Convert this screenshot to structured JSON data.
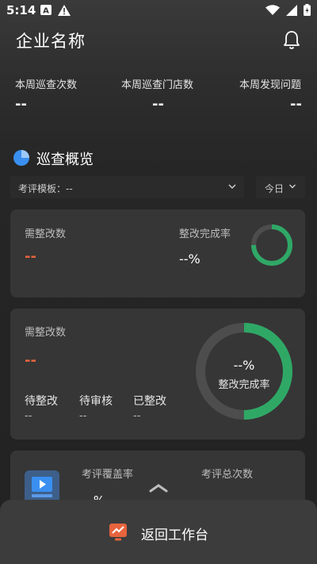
{
  "status_bar": {
    "time": "5:14",
    "badge_label": "A",
    "battery_glyph": "⚡"
  },
  "header": {
    "title": "企业名称",
    "bell_icon": "bell-icon"
  },
  "stats": [
    {
      "label": "本周巡查次数",
      "value": "--"
    },
    {
      "label": "本周巡查门店数",
      "value": "--"
    },
    {
      "label": "本周发现问题",
      "value": "--"
    }
  ],
  "overview": {
    "title": "巡查概览",
    "template_select": "考评模板：--",
    "date_select": "今日"
  },
  "card1": {
    "need_label": "需整改数",
    "need_value": "--",
    "rate_label": "整改完成率",
    "rate_value": "--%",
    "ring_fraction": 0.75
  },
  "card2": {
    "need_label": "需整改数",
    "need_value": "--",
    "ring_value": "--%",
    "ring_label": "整改完成率",
    "ring_fraction": 0.5,
    "sub": [
      {
        "label": "待整改",
        "value": "--"
      },
      {
        "label": "待审核",
        "value": "--"
      },
      {
        "label": "已整改",
        "value": "--"
      }
    ]
  },
  "card3": {
    "coverage_label": "考评覆盖率",
    "coverage_value": "--%",
    "total_label": "考评总次数"
  },
  "bottom_bar": {
    "label": "返回工作台"
  },
  "colors": {
    "accent_green": "#2fa866",
    "accent_red": "#e7643d",
    "accent_blue": "#3a8ff0",
    "ring_track": "#4d4d4d"
  }
}
